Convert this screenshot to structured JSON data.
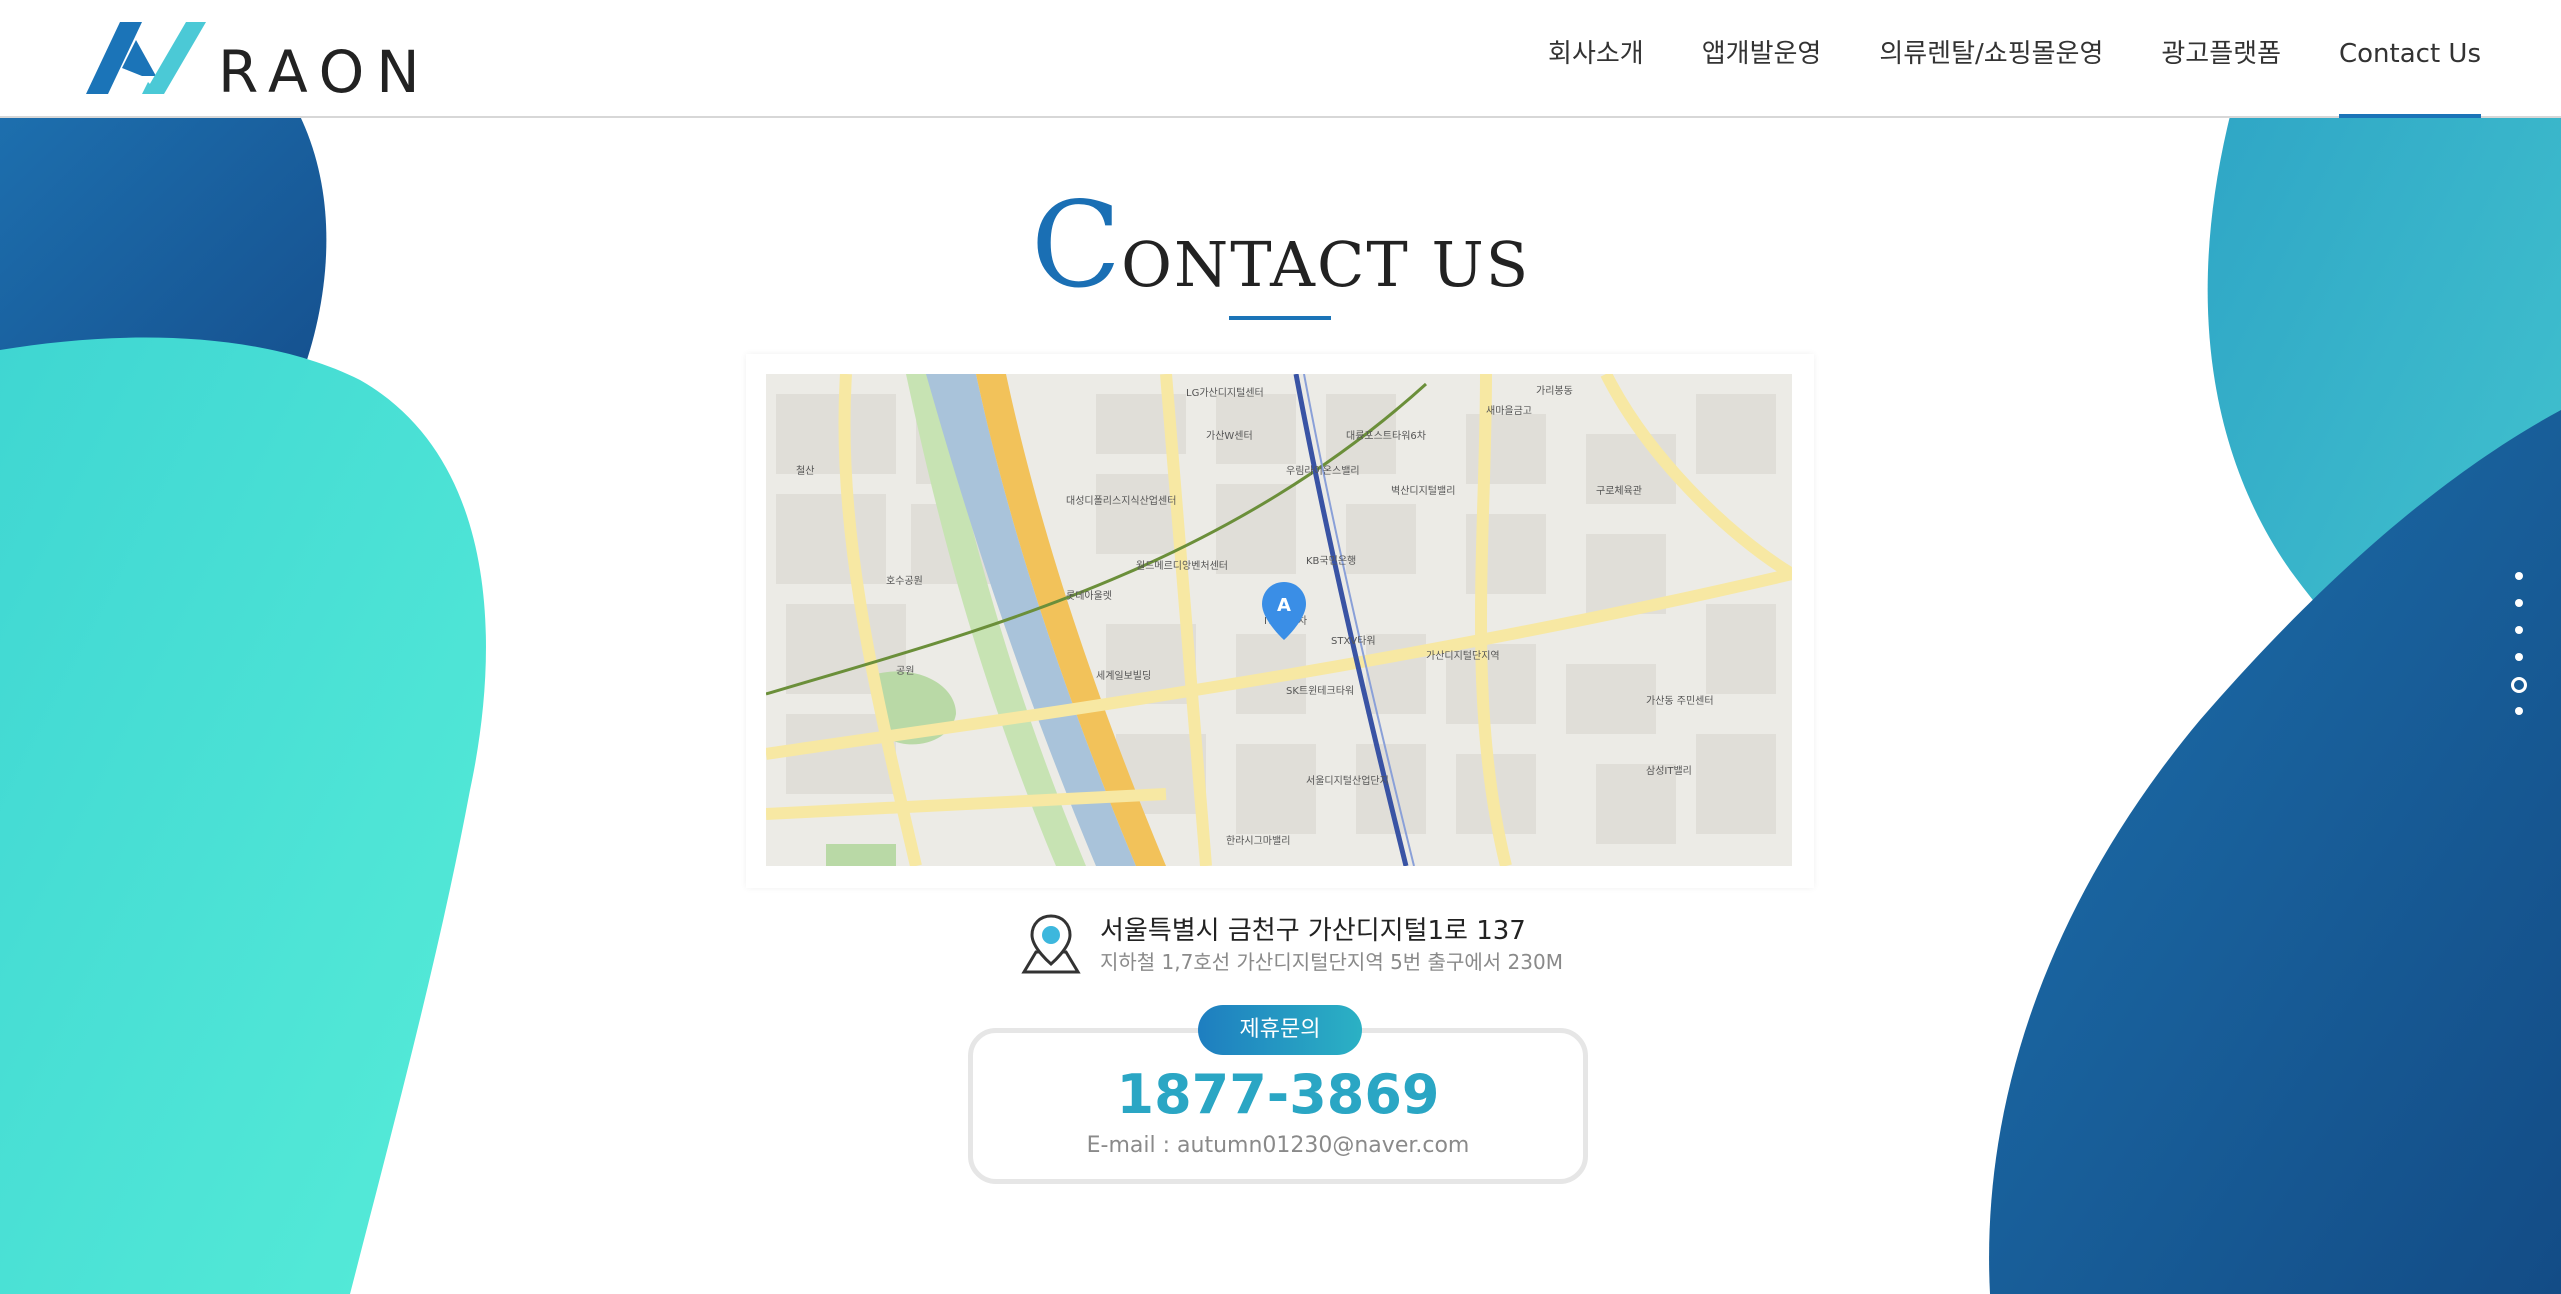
{
  "brand": {
    "name": "RAON",
    "colors": {
      "primary": "#1b74b8",
      "accent": "#2aa6c4",
      "teal": "#4de8d6"
    }
  },
  "nav": {
    "items": [
      {
        "label": "회사소개"
      },
      {
        "label": "앱개발운영"
      },
      {
        "label": "의류렌탈/쇼핑몰운영"
      },
      {
        "label": "광고플랫폼"
      },
      {
        "label": "Contact Us",
        "active": true
      }
    ]
  },
  "page": {
    "title_initial": "C",
    "title_rest": "ONTACT US"
  },
  "map": {
    "marker_label": "A",
    "labels": [
      "LG가산디지털센터",
      "가산W센터",
      "대륭포스트타워6차",
      "새마을금고",
      "벽산디지털밸리",
      "우림라이온스밸리",
      "KB국민은행",
      "월드메르디앙벤처센터",
      "IT캐슬2차",
      "STXV타워",
      "SK트윈테크타워",
      "서울디지털산업단지",
      "세계일보빌딩",
      "한라시그마밸리",
      "대성디폴리스지식산업센터",
      "롯데아울렛",
      "공원",
      "철산",
      "호수공원",
      "가리봉동",
      "구로체육관",
      "가산디지털단지역",
      "가산동 주민센터",
      "삼성IT밸리"
    ]
  },
  "address": {
    "main": "서울특별시 금천구 가산디지털1로 137",
    "sub": "지하철 1,7호선 가산디지털단지역 5번 출구에서 230M",
    "icon": "location-pin-icon"
  },
  "contact": {
    "badge": "제휴문의",
    "phone": "1877-3869",
    "email": "E-mail : autumn01230@naver.com"
  },
  "pager": {
    "count": 6,
    "active_index": 4
  }
}
